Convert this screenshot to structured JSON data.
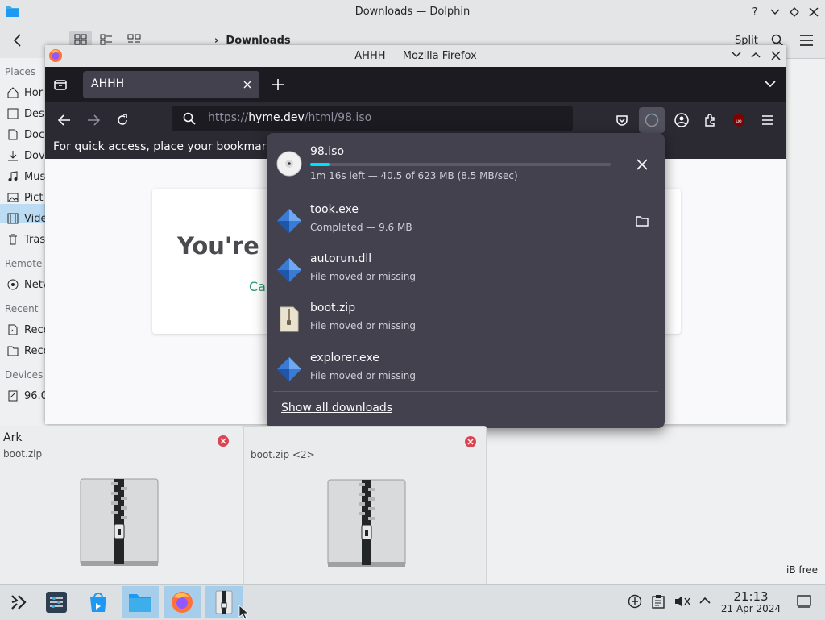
{
  "dolphin": {
    "title": "Downloads — Dolphin",
    "breadcrumb": "Downloads",
    "split_label": "Split",
    "sidebar": {
      "places_label": "Places",
      "items": [
        "Hor",
        "Des",
        "Doc",
        "Dov",
        "Mus",
        "Pict",
        "Vide",
        "Tras"
      ],
      "remote_label": "Remote",
      "remote_items": [
        "Netv"
      ],
      "recent_label": "Recent",
      "recent_items": [
        "Reco",
        "Reco"
      ],
      "devices_label": "Devices",
      "device_items": [
        "96.0"
      ]
    },
    "free_space": "iB free"
  },
  "firefox": {
    "window_title": "AHHH — Mozilla Firefox",
    "tab_title": "AHHH",
    "url_prefix": "https://",
    "url_host": "hyme.dev",
    "url_path": "/html/98.iso",
    "bookmarks_hint": "For quick access, place your bookmarks",
    "page_heading": "You're c",
    "page_link": "Ca"
  },
  "downloads": {
    "items": [
      {
        "name": "98.iso",
        "status": "1m 16s left — 40.5 of 623 MB (8.5 MB/sec)",
        "icon": "disc-icon",
        "progress": 0.065
      },
      {
        "name": "took.exe",
        "status": "Completed — 9.6 MB",
        "icon": "exe-icon"
      },
      {
        "name": "autorun.dll",
        "status": "File moved or missing",
        "icon": "exe-icon"
      },
      {
        "name": "boot.zip",
        "status": "File moved or missing",
        "icon": "zip-file-icon"
      },
      {
        "name": "explorer.exe",
        "status": "File moved or missing",
        "icon": "exe-icon"
      }
    ],
    "show_all": "Show all downloads"
  },
  "ark": {
    "title": "Ark",
    "left_file": "boot.zip",
    "right_file": "boot.zip <2>"
  },
  "taskbar": {
    "time": "21:13",
    "date": "21 Apr 2024"
  },
  "colors": {
    "progress": "#00ddff",
    "firefox_dark": "#2b2a33",
    "panel": "#42414d"
  }
}
